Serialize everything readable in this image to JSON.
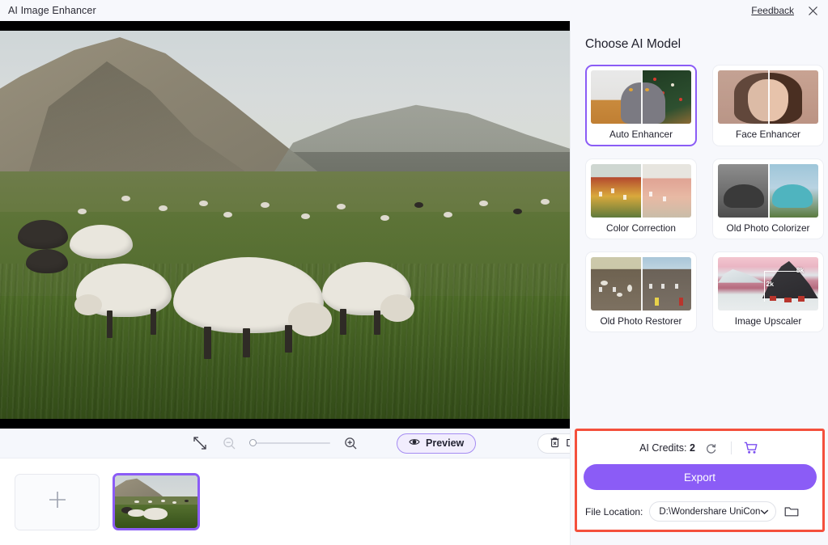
{
  "titlebar": {
    "title": "AI Image Enhancer",
    "feedback_label": "Feedback",
    "close_icon": "close-icon"
  },
  "canvas": {
    "image_description": "Flock of sheep grazing in a green pasture below a mountain",
    "letterbox_color": "#000000"
  },
  "toolbar": {
    "fit_icon": "fit-screen-icon",
    "zoom_out_icon": "zoom-out-icon",
    "zoom_in_icon": "zoom-in-icon",
    "zoom_value": 0,
    "preview_label": "Preview",
    "preview_icon": "eye-icon",
    "delete_all_label": "Delete All",
    "delete_all_icon": "trash-icon"
  },
  "filmstrip": {
    "add_icon": "plus-icon",
    "items": [
      {
        "name": "sheep-pasture",
        "selected": true
      }
    ]
  },
  "panel": {
    "title": "Choose AI Model",
    "models": [
      {
        "label": "Auto Enhancer",
        "selected": true
      },
      {
        "label": "Face Enhancer",
        "selected": false
      },
      {
        "label": "Color Correction",
        "selected": false
      },
      {
        "label": "Old Photo Colorizer",
        "selected": false
      },
      {
        "label": "Old Photo Restorer",
        "selected": false
      },
      {
        "label": "Image Upscaler",
        "selected": false
      }
    ],
    "upscaler_badges": {
      "low": "2k",
      "high": "8k"
    }
  },
  "export": {
    "credits_label": "AI Credits:",
    "credits_value": "2",
    "refresh_icon": "refresh-icon",
    "cart_icon": "shopping-cart-icon",
    "export_label": "Export",
    "file_location_label": "File Location:",
    "file_location_value": "D:\\Wondershare UniConv",
    "dropdown_icon": "chevron-down-icon",
    "folder_icon": "folder-icon",
    "highlight_color": "#f4503c"
  },
  "colors": {
    "accent": "#8b5cf6",
    "panel_bg": "#f7f8fc",
    "toolbar_bg": "#f5f7fc"
  }
}
